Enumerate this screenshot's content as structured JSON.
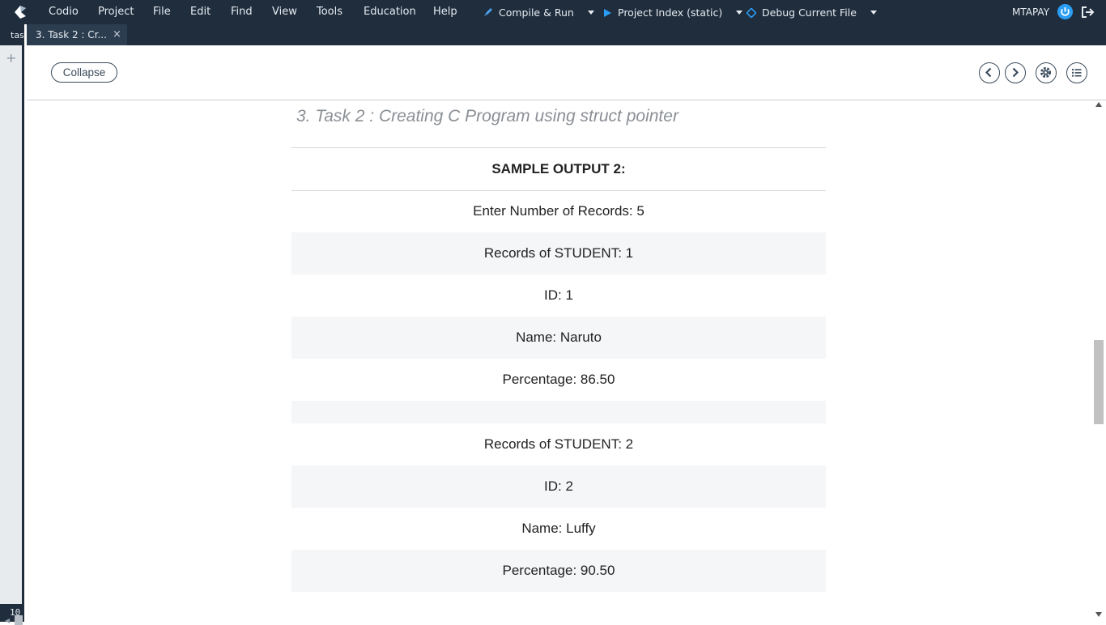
{
  "menubar": {
    "items": [
      "Codio",
      "Project",
      "File",
      "Edit",
      "Find",
      "View",
      "Tools",
      "Education",
      "Help"
    ],
    "compile_run": "Compile & Run",
    "project_index": "Project Index (static)",
    "debug": "Debug Current File",
    "user": "MTAPAY",
    "colors": {
      "bar": "#1f2d3d",
      "accent": "#2a9df4"
    }
  },
  "leftstrip": {
    "tab_stub": "tas",
    "line_num": "10"
  },
  "tabbar": {
    "active_tab": "3. Task 2 : Cr...",
    "close_glyph": "×"
  },
  "guide": {
    "collapse_label": "Collapse",
    "title": "3. Task 2 : Creating C Program using struct pointer",
    "table": {
      "header": "SAMPLE OUTPUT 2:",
      "rows": [
        "Enter Number of Records: 5",
        "Records of STUDENT: 1",
        "ID: 1",
        "Name: Naruto",
        "Percentage: 86.50",
        "",
        "Records of STUDENT: 2",
        "ID: 2",
        "Name: Luffy",
        "Percentage: 90.50",
        ""
      ]
    }
  }
}
